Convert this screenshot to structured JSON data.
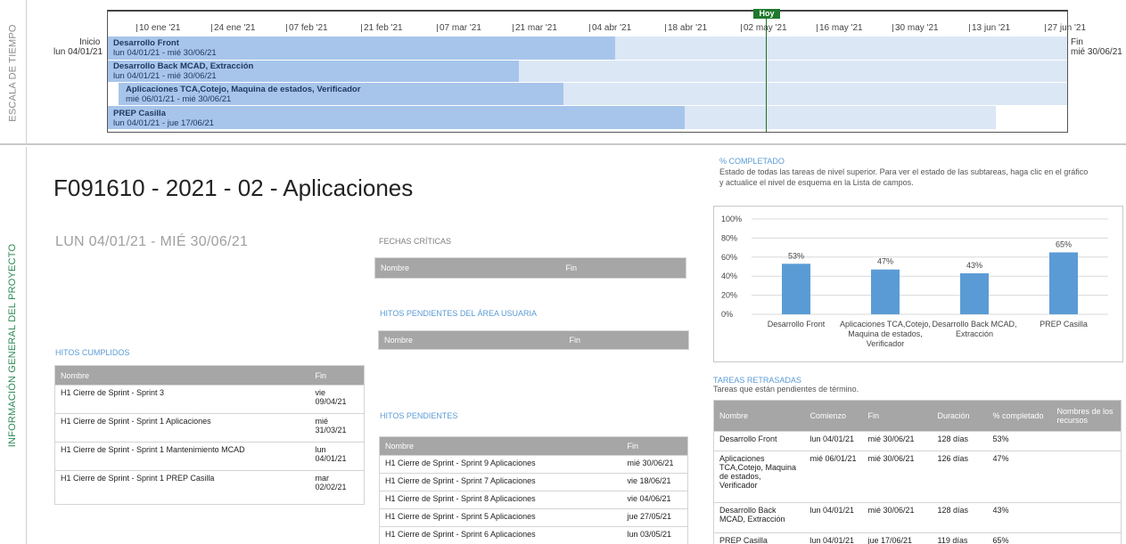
{
  "timeline": {
    "side_label": "ESCALA DE TIEMPO",
    "today_label": "Hoy",
    "start": {
      "label": "Inicio",
      "date": "lun 04/01/21"
    },
    "finish": {
      "label": "Fin",
      "date": "mié 30/06/21"
    },
    "ticks": [
      "10 ene '21",
      "24 ene '21",
      "07 feb '21",
      "21 feb '21",
      "07 mar '21",
      "21 mar '21",
      "04 abr '21",
      "18 abr '21",
      "02 may '21",
      "16 may '21",
      "30 may '21",
      "13 jun '21",
      "27 jun '21"
    ],
    "bars": [
      {
        "name": "Desarrollo Front",
        "dates": "lun 04/01/21 - mié 30/06/21"
      },
      {
        "name": "Desarrollo Back MCAD, Extracción",
        "dates": "lun 04/01/21 - mié 30/06/21"
      },
      {
        "name": "Aplicaciones TCA,Cotejo, Maquina de estados, Verificador",
        "dates": "mié 06/01/21 - mié 30/06/21"
      },
      {
        "name": "PREP Casilla",
        "dates": "lun 04/01/21 - jue 17/06/21"
      }
    ]
  },
  "overview": {
    "side_label": "INFORMACIÓN GENERAL DEL PROYECTO",
    "title": "F091610 - 2021 - 02 - Aplicaciones",
    "dates": "LUN 04/01/21 -  MIÉ 30/06/21"
  },
  "critical_dates": {
    "label": "FECHAS CRÍTICAS",
    "headers": [
      "Nombre",
      "Fin"
    ]
  },
  "user_milestones": {
    "label": "HITOS PENDIENTES DEL ÁREA USUARIA",
    "headers": [
      "Nombre",
      "Fin"
    ]
  },
  "completed_milestones": {
    "label": "HITOS CUMPLIDOS",
    "headers": [
      "Nombre",
      "Fin"
    ],
    "rows": [
      [
        "H1 Cierre de Sprint - Sprint 3",
        "vie 09/04/21"
      ],
      [
        " H1 Cierre de Sprint - Sprint 1 Aplicaciones",
        "mié 31/03/21"
      ],
      [
        "H1 Cierre de Sprint - Sprint 1 Mantenimiento MCAD",
        "lun 04/01/21"
      ],
      [
        "H1 Cierre de Sprint - Sprint 1 PREP Casilla",
        "mar 02/02/21"
      ]
    ]
  },
  "pending_milestones": {
    "label": "HITOS PENDIENTES",
    "headers": [
      "Nombre",
      "Fin"
    ],
    "rows": [
      [
        "H1 Cierre de Sprint - Sprint 9 Aplicaciones",
        "mié 30/06/21"
      ],
      [
        "H1 Cierre de Sprint - Sprint 7 Aplicaciones",
        "vie 18/06/21"
      ],
      [
        "H1 Cierre de Sprint - Sprint 8 Aplicaciones",
        "vie 04/06/21"
      ],
      [
        "H1 Cierre de Sprint - Sprint 5 Aplicaciones",
        "jue 27/05/21"
      ],
      [
        "H1 Cierre de Sprint - Sprint 6 Aplicaciones",
        "lun 03/05/21"
      ]
    ]
  },
  "percent_complete": {
    "label": "% COMPLETADO",
    "description": "Estado de todas las tareas de nivel superior. Para ver el estado de las subtareas, haga clic en el gráfico y actualice el nivel de esquema en la Lista de campos."
  },
  "chart_data": {
    "type": "bar",
    "categories": [
      [
        "Desarrollo Front"
      ],
      [
        "Aplicaciones TCA,Cotejo,",
        "Maquina de estados,",
        "Verificador"
      ],
      [
        "Desarrollo Back MCAD,",
        "Extracción"
      ],
      [
        "PREP Casilla"
      ]
    ],
    "values": [
      53,
      47,
      43,
      65
    ],
    "data_labels": [
      "53%",
      "47%",
      "43%",
      "65%"
    ],
    "y_ticks": [
      "0%",
      "20%",
      "40%",
      "60%",
      "80%",
      "100%"
    ],
    "ylim": [
      0,
      100
    ],
    "bar_color": "#5b9bd5",
    "grid": true,
    "title": "",
    "xlabel": "",
    "ylabel": ""
  },
  "delayed_tasks": {
    "label": "TAREAS RETRASADAS",
    "subtitle": "Tareas que están pendientes de término.",
    "headers": [
      "Nombre",
      "Comienzo",
      "Fin",
      "Duración",
      "% completado",
      "Nombres de los recursos"
    ],
    "rows": [
      [
        "Desarrollo Front",
        "lun 04/01/21",
        "mié 30/06/21",
        "128 días",
        "53%",
        ""
      ],
      [
        "Aplicaciones TCA,Cotejo, Maquina de estados, Verificador",
        "mié 06/01/21",
        "mié 30/06/21",
        "126 días",
        "47%",
        ""
      ],
      [
        "Desarrollo Back MCAD, Extracción",
        "lun 04/01/21",
        "mié 30/06/21",
        "128 días",
        "43%",
        ""
      ],
      [
        "PREP Casilla",
        "lun 04/01/21",
        "jue 17/06/21",
        "119 días",
        "65%",
        ""
      ]
    ]
  },
  "colors": {
    "accent": "#5b9bd5",
    "today": "#1f7a2c",
    "bar": "#a7c5ea",
    "bar_remaining": "#dbe7f5",
    "header_grey": "#a6a6a6"
  }
}
